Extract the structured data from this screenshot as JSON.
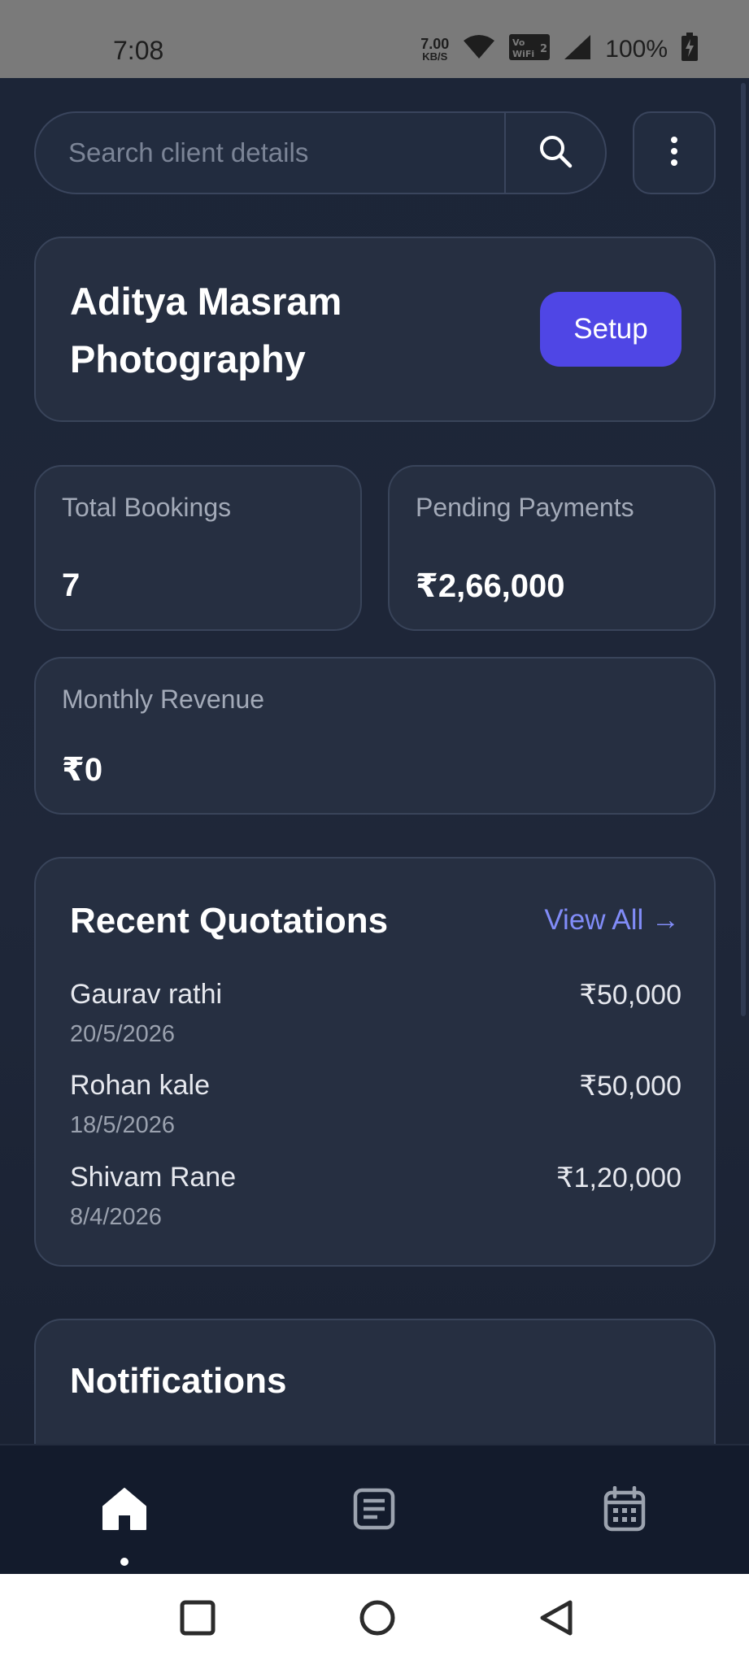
{
  "status_bar": {
    "time": "7:08",
    "net_speed_value": "7.00",
    "net_speed_unit": "KB/S",
    "vowifi_label": "Vo WiFi 2",
    "battery": "100%"
  },
  "search": {
    "placeholder": "Search client details",
    "value": ""
  },
  "business": {
    "name": "Aditya Masram Photography",
    "setup_label": "Setup"
  },
  "stats": {
    "total_bookings_label": "Total Bookings",
    "total_bookings_value": "7",
    "pending_payments_label": "Pending Payments",
    "pending_payments_value": "₹2,66,000",
    "monthly_revenue_label": "Monthly Revenue",
    "monthly_revenue_value": "₹0"
  },
  "quotations": {
    "title": "Recent Quotations",
    "view_all": "View All →",
    "items": [
      {
        "name": "Gaurav rathi",
        "date": "20/5/2026",
        "amount": "₹50,000"
      },
      {
        "name": "Rohan kale",
        "date": "18/5/2026",
        "amount": "₹50,000"
      },
      {
        "name": "Shivam Rane",
        "date": "8/4/2026",
        "amount": "₹1,20,000"
      }
    ]
  },
  "notifications": {
    "title": "Notifications"
  },
  "bottom_nav": {
    "items": [
      {
        "icon": "home-icon",
        "active": true
      },
      {
        "icon": "document-list-icon",
        "active": false
      },
      {
        "icon": "calendar-icon",
        "active": false
      }
    ]
  },
  "colors": {
    "background": "#1b2436",
    "card": "#262f41",
    "accent": "#4f46e5",
    "link": "#818cf8"
  }
}
